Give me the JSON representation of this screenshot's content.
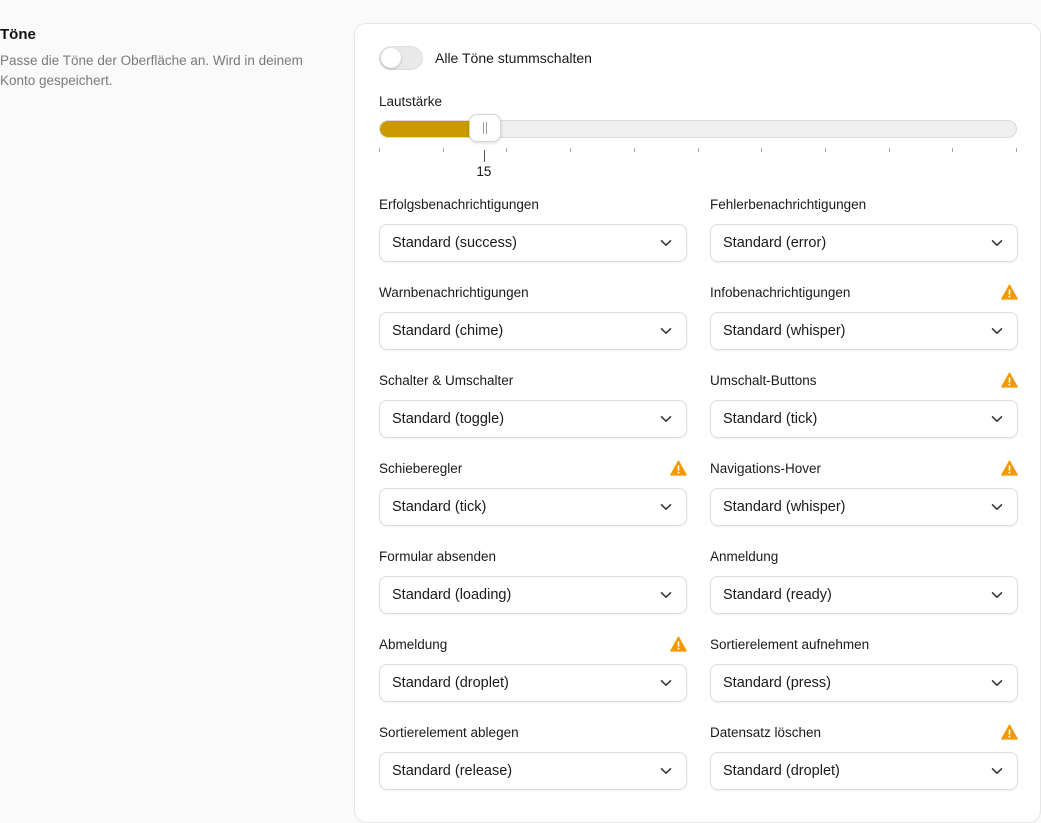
{
  "section": {
    "title": "Töne",
    "description": "Passe die Töne der Oberfläche an. Wird in deinem Konto gespeichert."
  },
  "mute": {
    "label": "Alle Töne stummschalten",
    "enabled": false
  },
  "volume": {
    "label": "Lautstärke",
    "value": 15,
    "value_text": "15",
    "min": 0,
    "max": 100,
    "accent": "#cc9800"
  },
  "sounds": [
    {
      "label": "Erfolgsbenachrichtigungen",
      "value": "Standard (success)",
      "warning": false
    },
    {
      "label": "Fehlerbenachrichtigungen",
      "value": "Standard (error)",
      "warning": false
    },
    {
      "label": "Warnbenachrichtigungen",
      "value": "Standard (chime)",
      "warning": false
    },
    {
      "label": "Infobenachrichtigungen",
      "value": "Standard (whisper)",
      "warning": true
    },
    {
      "label": "Schalter & Umschalter",
      "value": "Standard (toggle)",
      "warning": false
    },
    {
      "label": "Umschalt-Buttons",
      "value": "Standard (tick)",
      "warning": true
    },
    {
      "label": "Schieberegler",
      "value": "Standard (tick)",
      "warning": true
    },
    {
      "label": "Navigations-Hover",
      "value": "Standard (whisper)",
      "warning": true
    },
    {
      "label": "Formular absenden",
      "value": "Standard (loading)",
      "warning": false
    },
    {
      "label": "Anmeldung",
      "value": "Standard (ready)",
      "warning": false
    },
    {
      "label": "Abmeldung",
      "value": "Standard (droplet)",
      "warning": true
    },
    {
      "label": "Sortierelement aufnehmen",
      "value": "Standard (press)",
      "warning": false
    },
    {
      "label": "Sortierelement ablegen",
      "value": "Standard (release)",
      "warning": false
    },
    {
      "label": "Datensatz löschen",
      "value": "Standard (droplet)",
      "warning": true
    }
  ],
  "icons": {
    "warning": "warning-triangle-icon",
    "dropdown": "chevron-down-icon"
  },
  "colors": {
    "warning": "#f29900",
    "accent": "#cc9800"
  }
}
